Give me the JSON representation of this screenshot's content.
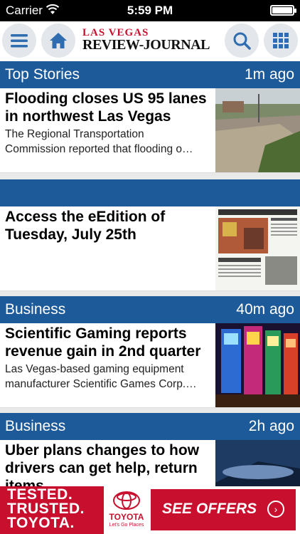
{
  "status_bar": {
    "carrier": "Carrier",
    "time": "5:59 PM"
  },
  "header": {
    "logo_line1": "LAS VEGAS",
    "logo_line2": "REVIEW-JOURNAL",
    "icons": [
      "menu-icon",
      "home-icon",
      "search-icon",
      "grid-icon"
    ]
  },
  "colors": {
    "section_bar": "#1d5a99",
    "brand_red": "#c8102e"
  },
  "stories": [
    {
      "section": "Top Stories",
      "ago": "1m ago",
      "title": "Flooding closes US 95 lanes in northwest Las Vegas",
      "desc": "The Regional Transportation Commission reported that flooding o…"
    },
    {
      "section": "",
      "ago": "",
      "title": "Access the eEdition of Tuesday, July 25th",
      "desc": ""
    },
    {
      "section": "Business",
      "ago": "40m ago",
      "title": "Scientific Gaming reports revenue gain in 2nd quarter",
      "desc": "Las Vegas-based gaming equipment manufacturer Scientific Games Corp.…"
    },
    {
      "section": "Business",
      "ago": "2h ago",
      "title": "Uber plans changes to how drivers can get help, return items",
      "desc": ""
    }
  ],
  "ad": {
    "line1": "TESTED.",
    "line2": "TRUSTED.",
    "line3": "TOYOTA.",
    "brand": "TOYOTA",
    "tagline": "Let's Go Places",
    "cta": "SEE OFFERS"
  }
}
